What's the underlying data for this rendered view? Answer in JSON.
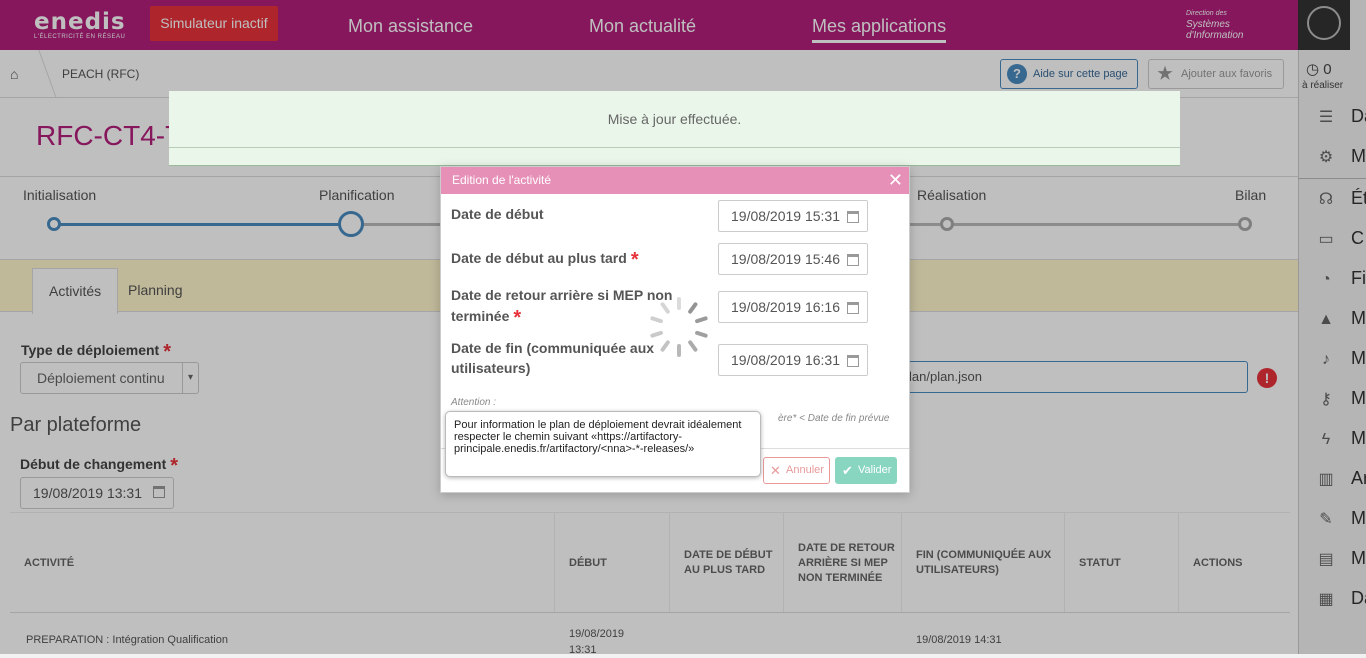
{
  "header": {
    "logo": "enedis",
    "logo_sub": "L'ÉLECTRICITÉ EN RÉSEAU",
    "simulator": "Simulateur inactif",
    "nav": [
      "Mon assistance",
      "Mon actualité",
      "Mes applications"
    ],
    "dsi": [
      "Direction des",
      "Systèmes",
      "d'Information"
    ]
  },
  "sidebar": {
    "count": "0",
    "count_label": "à réaliser",
    "items": [
      "Da",
      "M",
      "Ét",
      "C",
      "Fi",
      "M",
      "M",
      "M",
      "M",
      "Ar",
      "M",
      "M",
      "Da"
    ]
  },
  "breadcrumb": {
    "item": "PEACH (RFC)",
    "help": "Aide sur cette page",
    "fav": "Ajouter aux favoris"
  },
  "page": {
    "title": "RFC-CT4-T",
    "steps": [
      "Initialisation",
      "Planification",
      "Réalisation",
      "Bilan"
    ],
    "tabs": [
      "Activités",
      "Planning"
    ],
    "type_label": "Type de déploiement",
    "type_value": "Déploiement continu",
    "json_value": "lan/plan.json",
    "section": "Par plateforme",
    "debut_label": "Début de changement",
    "debut_value": "19/08/2019 13:31"
  },
  "table": {
    "headers": [
      "ACTIVITÉ",
      "DÉBUT",
      "DATE DE DÉBUT AU PLUS TARD",
      "DATE DE RETOUR ARRIÈRE SI MEP NON TERMINÉE",
      "FIN (COMMUNIQUÉE AUX UTILISATEURS)",
      "STATUT",
      "ACTIONS"
    ],
    "row": {
      "activity": "PREPARATION : Intégration Qualification",
      "start": "19/08/2019 13:31",
      "end": "19/08/2019 14:31"
    }
  },
  "notice": "Mise à jour effectuée.",
  "modal": {
    "title": "Edition de l'activité",
    "fields": [
      {
        "label": "Date de début",
        "value": "19/08/2019 15:31"
      },
      {
        "label": "Date de début au plus tard",
        "value": "19/08/2019 15:46"
      },
      {
        "label": "Date de retour arrière si MEP non terminée",
        "value": "19/08/2019 16:16"
      },
      {
        "label": "Date de fin (communiquée aux utilisateurs)",
        "value": "19/08/2019 16:31"
      }
    ],
    "attention": "Attention :",
    "attention_rule": "ère* < Date de fin prévue",
    "tooltip": "Pour information le plan de déploiement devrait idéalement respecter le chemin suivant «https://artifactory-principale.enedis.fr/artifactory/<nna>-*-releases/»",
    "cancel": "Annuler",
    "validate": "Valider"
  },
  "colors": {
    "brand": "#b31f7d",
    "modal_header": "#e690b8",
    "accent": "#4a8bc1",
    "danger": "#e8323a"
  }
}
